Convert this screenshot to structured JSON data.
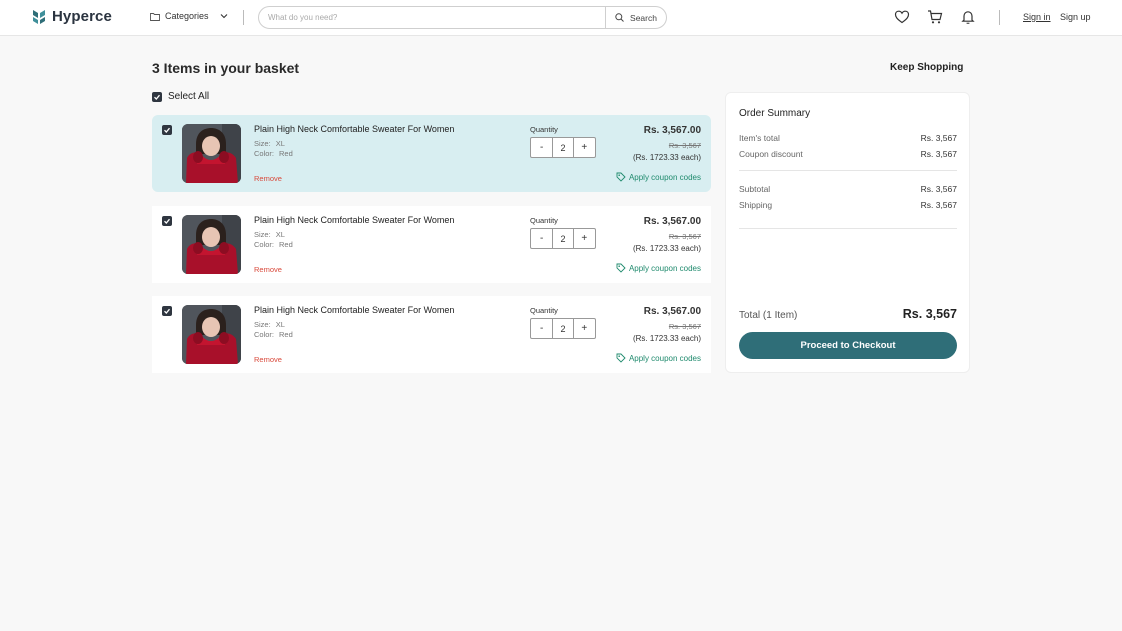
{
  "header": {
    "brand": "Hyperce",
    "categories_label": "Categories",
    "search_placeholder": "What do you need?",
    "search_button": "Search",
    "sign_in": "Sign in",
    "sign_up": "Sign up",
    "icons": [
      "heart-icon",
      "cart-icon",
      "bell-icon"
    ]
  },
  "basket": {
    "title": "3 Items in your basket",
    "keep_shopping": "Keep Shopping",
    "select_all": "Select All",
    "quantity_label": "Quantity",
    "remove_label": "Remove",
    "coupon_label": "Apply coupon codes",
    "items": [
      {
        "name": "Plain High Neck Comfortable Sweater For Women",
        "size_label": "Size:",
        "size": "XL",
        "color_label": "Color:",
        "color": "Red",
        "quantity": "2",
        "price": "Rs. 3,567.00",
        "old_price": "Rs. 3,567",
        "each": "(Rs. 1723.33 each)",
        "checked": true,
        "highlighted": true
      },
      {
        "name": "Plain High Neck Comfortable Sweater For Women",
        "size_label": "Size:",
        "size": "XL",
        "color_label": "Color:",
        "color": "Red",
        "quantity": "2",
        "price": "Rs. 3,567.00",
        "old_price": "Rs. 3,567",
        "each": "(Rs. 1723.33 each)",
        "checked": true,
        "highlighted": false
      },
      {
        "name": "Plain High Neck Comfortable Sweater For Women",
        "size_label": "Size:",
        "size": "XL",
        "color_label": "Color:",
        "color": "Red",
        "quantity": "2",
        "price": "Rs. 3,567.00",
        "old_price": "Rs. 3,567",
        "each": "(Rs. 1723.33 each)",
        "checked": true,
        "highlighted": false
      }
    ]
  },
  "summary": {
    "title": "Order Summary",
    "items_total_label": "Item's total",
    "items_total": "Rs. 3,567",
    "coupon_label": "Coupon discount",
    "coupon": "Rs. 3,567",
    "subtotal_label": "Subtotal",
    "subtotal": "Rs. 3,567",
    "shipping_label": "Shipping",
    "shipping": "Rs. 3,567",
    "total_label": "Total (1 Item)",
    "total": "Rs. 3,567",
    "checkout_label": "Proceed to Checkout"
  },
  "colors": {
    "accent": "#2f6e78",
    "highlight_bg": "#d8eef1",
    "remove": "#d9493b",
    "coupon": "#1f8a6d"
  }
}
